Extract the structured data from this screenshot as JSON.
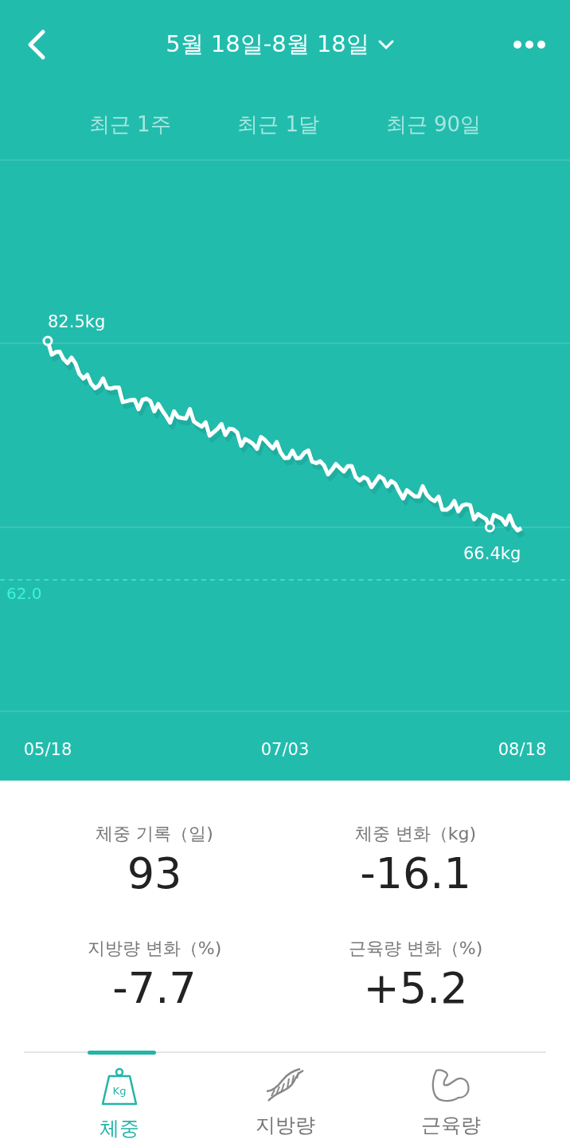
{
  "header": {
    "title": "5월 18일-8월 18일"
  },
  "range_tabs": [
    {
      "label": "최근 1주"
    },
    {
      "label": "최근 1달"
    },
    {
      "label": "최근 90일"
    }
  ],
  "chart": {
    "start_label": "82.5kg",
    "end_label": "66.4kg",
    "reference_label": "62.0",
    "x_labels": [
      "05/18",
      "07/03",
      "08/18"
    ]
  },
  "stats": [
    {
      "label": "체중 기록（일)",
      "value": "93"
    },
    {
      "label": "체중 변화（kg)",
      "value": "-16.1"
    },
    {
      "label": "지방량 변화（%)",
      "value": "-7.7"
    },
    {
      "label": "근육량 변화（%)",
      "value": "+5.2"
    }
  ],
  "bottom_tabs": [
    {
      "label": "체중",
      "kind": "weight",
      "icon_text": "Kg",
      "selected": true
    },
    {
      "label": "지방량",
      "kind": "dna",
      "selected": false
    },
    {
      "label": "근육량",
      "kind": "muscle",
      "selected": false
    }
  ]
}
